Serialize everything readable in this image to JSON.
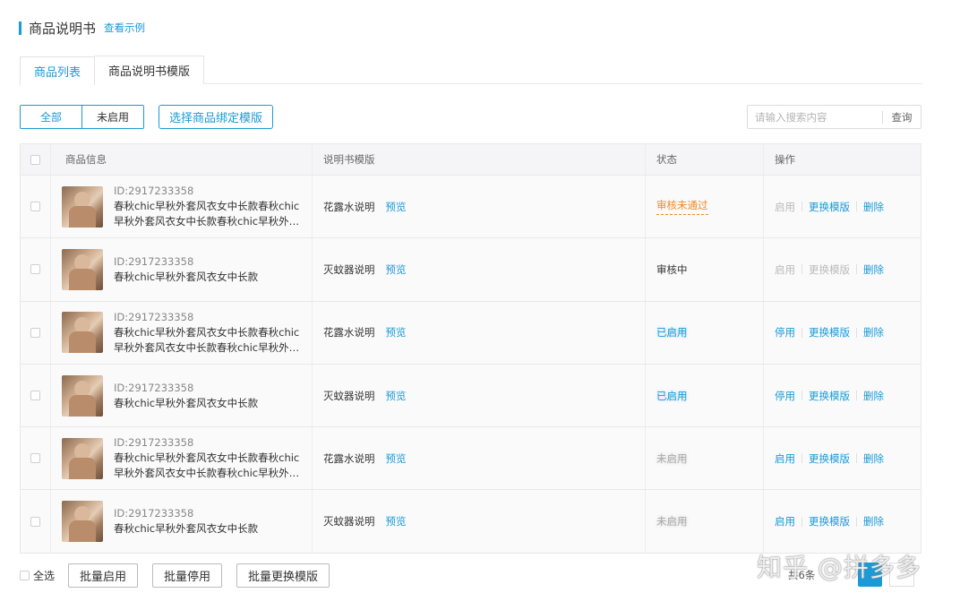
{
  "header": {
    "title": "商品说明书",
    "example_link": "查看示例"
  },
  "tabs": [
    {
      "label": "商品列表",
      "active": true
    },
    {
      "label": "商品说明书模版",
      "active": false
    }
  ],
  "filters": {
    "all_label": "全部",
    "inactive_label": "未启用",
    "bind_template_label": "选择商品绑定模版"
  },
  "search": {
    "placeholder": "请输入搜索内容",
    "button_label": "查询"
  },
  "table": {
    "headers": [
      "商品信息",
      "说明书模版",
      "状态",
      "操作"
    ],
    "rows": [
      {
        "id": "ID:2917233358",
        "name": "春秋chic早秋外套风衣女中长款春秋chic早秋外套风衣女中长款春秋chic早秋外套风衣女中长款",
        "template": "花露水说明",
        "preview": "预览",
        "status": "审核未通过",
        "op1": "启用",
        "op2": "更换模版",
        "op3": "删除"
      },
      {
        "id": "ID:2917233358",
        "name": "春秋chic早秋外套风衣女中长款",
        "template": "灭蚊器说明",
        "preview": "预览",
        "status": "审核中",
        "op1": "启用",
        "op2": "更换模版",
        "op3": "删除"
      },
      {
        "id": "ID:2917233358",
        "name": "春秋chic早秋外套风衣女中长款春秋chic早秋外套风衣女中长款春秋chic早秋外套风衣女中长款",
        "template": "花露水说明",
        "preview": "预览",
        "status": "已启用",
        "op1": "停用",
        "op2": "更换模版",
        "op3": "删除"
      },
      {
        "id": "ID:2917233358",
        "name": "春秋chic早秋外套风衣女中长款",
        "template": "灭蚊器说明",
        "preview": "预览",
        "status": "已启用",
        "op1": "停用",
        "op2": "更换模版",
        "op3": "删除"
      },
      {
        "id": "ID:2917233358",
        "name": "春秋chic早秋外套风衣女中长款春秋chic早秋外套风衣女中长款春秋chic早秋外套风衣女中长款",
        "template": "花露水说明",
        "preview": "预览",
        "status": "未启用",
        "op1": "启用",
        "op2": "更换模版",
        "op3": "删除"
      },
      {
        "id": "ID:2917233358",
        "name": "春秋chic早秋外套风衣女中长款",
        "template": "灭蚊器说明",
        "preview": "预览",
        "status": "未启用",
        "op1": "启用",
        "op2": "更换模版",
        "op3": "删除"
      }
    ]
  },
  "footer": {
    "select_all_label": "全选",
    "batch_enable_label": "批量启用",
    "batch_disable_label": "批量停用",
    "batch_change_label": "批量更换模版"
  },
  "pagination": {
    "total_text": "共6条"
  },
  "watermark": "知乎 @拼多多",
  "colors": {
    "accent": "#1a9ad6",
    "warning": "#f08a24",
    "disabled": "#aaaaaa"
  }
}
